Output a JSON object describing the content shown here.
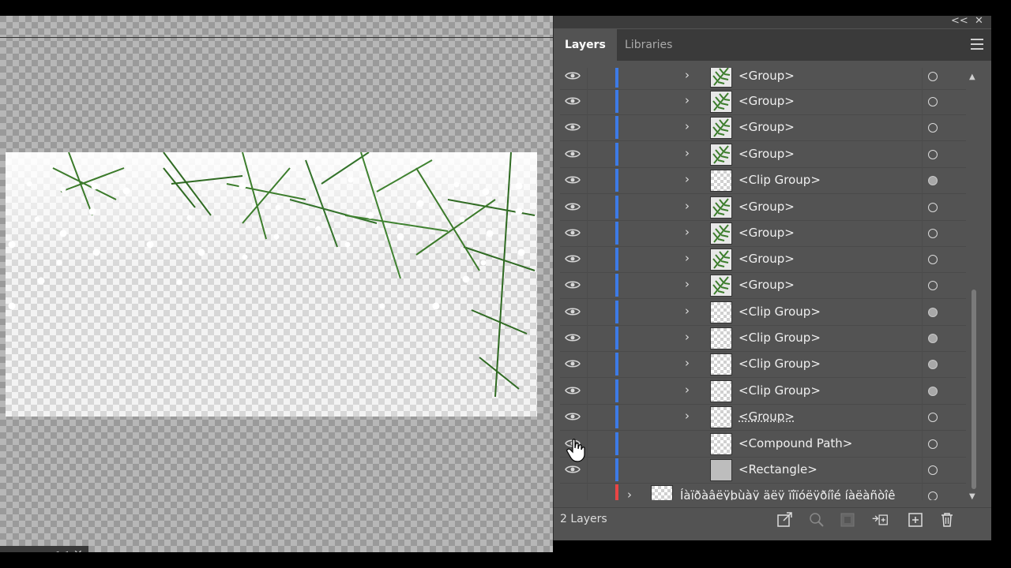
{
  "panel": {
    "tabs": [
      {
        "label": "Layers"
      },
      {
        "label": "Libraries"
      }
    ],
    "collapse_label": "<<",
    "close_label": "✕",
    "menu_icon": "hamburger-menu-icon",
    "footer": {
      "count": "2 Layers",
      "buttons": [
        "collect-for-export-icon",
        "locate-object-icon",
        "make-clipping-mask-icon",
        "create-sublayer-icon",
        "create-new-layer-icon",
        "delete-icon"
      ]
    }
  },
  "layers": [
    {
      "label": "<Group>",
      "thumb": "pine",
      "target": "empty",
      "arrow": "›"
    },
    {
      "label": "<Group>",
      "thumb": "pine",
      "target": "empty",
      "arrow": "›"
    },
    {
      "label": "<Group>",
      "thumb": "pine",
      "target": "empty",
      "arrow": "›"
    },
    {
      "label": "<Group>",
      "thumb": "pine",
      "target": "empty",
      "arrow": "›"
    },
    {
      "label": "<Clip Group>",
      "thumb": "checker",
      "target": "filled",
      "arrow": "›"
    },
    {
      "label": "<Group>",
      "thumb": "pine",
      "target": "empty",
      "arrow": "›"
    },
    {
      "label": "<Group>",
      "thumb": "pine",
      "target": "empty",
      "arrow": "›"
    },
    {
      "label": "<Group>",
      "thumb": "pine",
      "target": "empty",
      "arrow": "›"
    },
    {
      "label": "<Group>",
      "thumb": "pine",
      "target": "empty",
      "arrow": "›"
    },
    {
      "label": "<Clip Group>",
      "thumb": "checker",
      "target": "filled",
      "arrow": "›"
    },
    {
      "label": "<Clip Group>",
      "thumb": "checker",
      "target": "filled",
      "arrow": "›"
    },
    {
      "label": "<Clip Group>",
      "thumb": "checker",
      "target": "filled",
      "arrow": "›"
    },
    {
      "label": "<Clip Group>",
      "thumb": "checker",
      "target": "filled",
      "arrow": "›"
    },
    {
      "label": "<Group>",
      "thumb": "checker",
      "target": "empty",
      "arrow": "›"
    },
    {
      "label": "<Compound Path>",
      "thumb": "checker",
      "target": "empty",
      "arrow": ""
    },
    {
      "label": "<Rectangle>",
      "thumb": "gray",
      "target": "empty",
      "arrow": ""
    },
    {
      "label": "Íàïðàâëÿþùàÿ äëÿ ïîïóëÿðíîé íàëàñòîê",
      "thumb": "checker",
      "target": "empty",
      "arrow": "›"
    }
  ],
  "mini_panel": {
    "collapse_label": "<<",
    "close_label": "✕"
  },
  "colors": {
    "layer_blue": "#3d7be6",
    "layer_red": "#e94545",
    "panel_bg": "#535353"
  }
}
